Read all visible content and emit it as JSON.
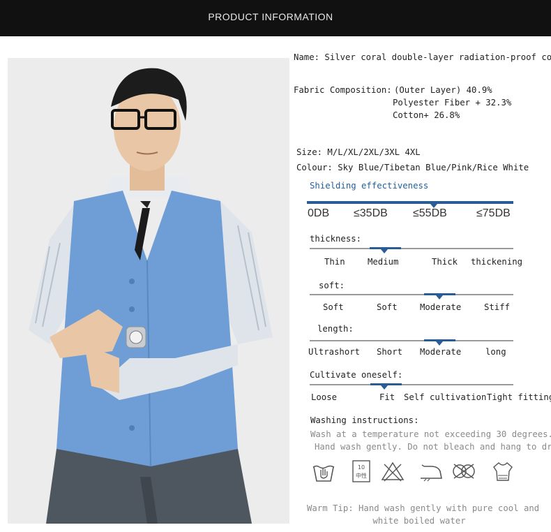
{
  "header": {
    "title": "PRODUCT INFORMATION"
  },
  "info": {
    "name": "Name: Silver coral double-layer radiation-proof coat",
    "fabric_label": "Fabric Composition:",
    "fabric_lines": [
      "(Outer Layer) 40.9%",
      "Polyester Fiber + 32.3%",
      "Cotton+ 26.8%"
    ],
    "size": "Size: M/L/XL/2XL/3XL 4XL",
    "colour": "Colour: Sky Blue/Tibetan Blue/Pink/Rice White"
  },
  "shielding": {
    "title": "Shielding effectiveness",
    "scale": [
      "0DB",
      "≤35DB",
      "≤55DB",
      "≤75DB"
    ],
    "selected": "≤55DB"
  },
  "thickness": {
    "label": "thickness:",
    "options": [
      "Thin",
      "Medium",
      "Thick",
      "thickening"
    ],
    "selected": "Medium"
  },
  "soft": {
    "label": "soft:",
    "options": [
      "Soft",
      "Soft",
      "Moderate",
      "Stiff"
    ],
    "selected": "Moderate"
  },
  "length": {
    "label": "length:",
    "options": [
      "Ultrashort",
      "Short",
      "Moderate",
      "long"
    ],
    "selected": "Moderate"
  },
  "cultivate": {
    "label": "Cultivate oneself:",
    "options": [
      "Loose",
      "Fit",
      "Self cultivation",
      "Tight fitting"
    ],
    "selected": "Fit"
  },
  "washing": {
    "label": "Washing instructions:",
    "lines": [
      "Wash at a temperature not exceeding 30 degrees.",
      "Hand wash gently. Do not bleach and hang to dry."
    ],
    "icons": [
      "hand-wash-icon",
      "neutral-detergent-icon",
      "no-bleach-icon",
      "low-iron-icon",
      "no-tumble-dry-icon",
      "hang-dry-icon"
    ],
    "detergent_text": {
      "top": "10",
      "bottom": "中性"
    }
  },
  "tip": {
    "lines": [
      "Warm Tip: Hand wash gently with pure cool and",
      "white boiled water"
    ]
  },
  "colors": {
    "accent": "#2a5d96",
    "header_bg": "#111111",
    "vest": "#6f9ed6"
  }
}
